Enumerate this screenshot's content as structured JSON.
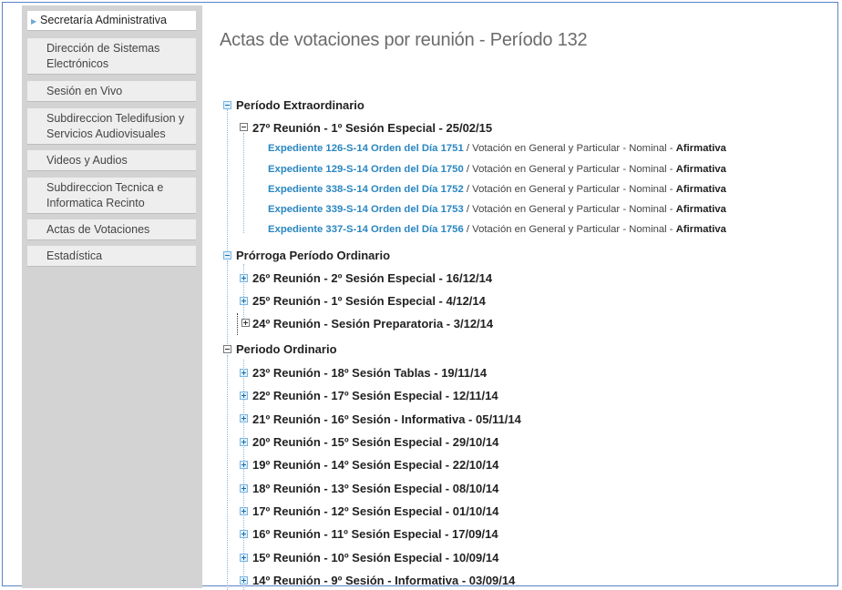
{
  "sidebar": {
    "items": [
      {
        "label": "Secretaría Administrativa"
      },
      {
        "label": "Dirección de Sistemas Electrónicos"
      },
      {
        "label": "Sesión en Vivo"
      },
      {
        "label": "Subdireccion Teledifusion y Servicios Audiovisuales"
      },
      {
        "label": "Videos y Audios"
      },
      {
        "label": "Subdireccion Tecnica e Informatica Recinto"
      },
      {
        "label": "Actas de Votaciones"
      },
      {
        "label": "Estadística"
      }
    ]
  },
  "page": {
    "title": "Actas de votaciones por reunión - Período 132"
  },
  "tree": {
    "period1": {
      "label": "Período Extraordinario",
      "meeting": {
        "label": "27º Reunión - 1º Sesión Especial - 25/02/15",
        "items": [
          {
            "link": "Expediente 126-S-14 Orden del Día 1751",
            "desc": " / Votación en General y Particular  - Nominal - ",
            "result": "Afirmativa"
          },
          {
            "link": "Expediente 129-S-14 Orden del Día 1750",
            "desc": " / Votación en General y Particular  - Nominal - ",
            "result": "Afirmativa"
          },
          {
            "link": "Expediente 338-S-14 Orden del Día 1752",
            "desc": " / Votación en General y Particular  - Nominal - ",
            "result": "Afirmativa"
          },
          {
            "link": "Expediente 339-S-14 Orden del Día 1753",
            "desc": " / Votación en General y Particular  - Nominal - ",
            "result": "Afirmativa"
          },
          {
            "link": "Expediente 337-S-14 Orden del Día 1756",
            "desc": " / Votación en General y Particular  - Nominal - ",
            "result": "Afirmativa"
          }
        ]
      }
    },
    "period2": {
      "label": "Prórroga Período Ordinario",
      "meetings": [
        "26º Reunión - 2º Sesión Especial - 16/12/14",
        "25º Reunión - 1º Sesión Especial - 4/12/14",
        "24º Reunión -  Sesión Preparatoria - 3/12/14"
      ]
    },
    "period3": {
      "label": "Periodo Ordinario",
      "meetings": [
        "23º Reunión - 18º Sesión Tablas - 19/11/14",
        "22º Reunión - 17º Sesión Especial - 12/11/14",
        "21º Reunión - 16º Sesión - Informativa - 05/11/14",
        "20º Reunión - 15º Sesión Especial - 29/10/14",
        "19º Reunión - 14º Sesión Especial - 22/10/14",
        "18º Reunión - 13º Sesión Especial - 08/10/14",
        "17º Reunión - 12º Sesión Especial - 01/10/14",
        "16º Reunión - 11º Sesión Especial - 17/09/14",
        "15º Reunión - 10º Sesión Especial - 10/09/14",
        "14º Reunión - 9º Sesión - Informativa - 03/09/14"
      ]
    }
  }
}
